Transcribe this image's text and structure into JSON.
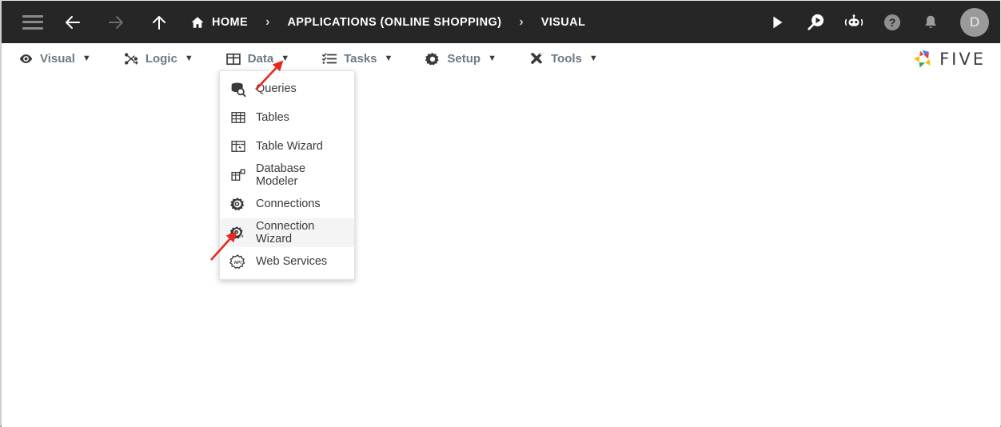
{
  "colors": {
    "topbar_bg": "#262626",
    "accent_bar": "#f5a623",
    "menu_label": "#6d7a86",
    "annotation_arrow": "#e8281e",
    "avatar_bg": "#9a9a9a",
    "dropdown_hover": "#f4f4f4"
  },
  "topbar": {
    "menu_toggle": "hamburger-icon",
    "back_label": "back-arrow-icon",
    "forward_label": "forward-arrow-icon",
    "up_label": "up-arrow-icon",
    "breadcrumbs": [
      {
        "label": "HOME",
        "icon": "home-icon"
      },
      {
        "label": "APPLICATIONS (ONLINE SHOPPING)",
        "icon": ""
      },
      {
        "label": "VISUAL",
        "icon": ""
      }
    ],
    "separator": "›",
    "actions": [
      {
        "name": "run-button",
        "icon": "play-icon"
      },
      {
        "name": "search-run-button",
        "icon": "search-play-icon"
      },
      {
        "name": "assistant-button",
        "icon": "robot-icon"
      },
      {
        "name": "help-button",
        "icon": "question-circle-icon"
      },
      {
        "name": "notifications-button",
        "icon": "bell-icon"
      }
    ],
    "avatar_initial": "D"
  },
  "menubar": {
    "items": [
      {
        "label": "Visual",
        "icon": "eye-icon",
        "caret": "▼"
      },
      {
        "label": "Logic",
        "icon": "nodes-icon",
        "caret": "▼"
      },
      {
        "label": "Data",
        "icon": "table-grid-icon",
        "caret": "▼"
      },
      {
        "label": "Tasks",
        "icon": "checklist-icon",
        "caret": "▼"
      },
      {
        "label": "Setup",
        "icon": "gear-icon",
        "caret": "▼"
      },
      {
        "label": "Tools",
        "icon": "tools-icon",
        "caret": "▼"
      }
    ],
    "brand": {
      "word": "FIVE",
      "logo_colors": [
        "#4285f4",
        "#ea4335",
        "#fbbc05",
        "#34a853"
      ]
    }
  },
  "data_menu": {
    "open": true,
    "items": [
      {
        "label": "Queries",
        "icon": "database-search-icon",
        "active": false
      },
      {
        "label": "Tables",
        "icon": "table-grid-icon",
        "active": false
      },
      {
        "label": "Table Wizard",
        "icon": "table-wizard-icon",
        "active": false
      },
      {
        "label": "Database Modeler",
        "icon": "database-modeler-icon",
        "active": false
      },
      {
        "label": "Connections",
        "icon": "connections-icon",
        "active": false
      },
      {
        "label": "Connection Wizard",
        "icon": "connection-wizard-icon",
        "active": true
      },
      {
        "label": "Web Services",
        "icon": "api-icon",
        "active": false
      }
    ]
  },
  "annotations": [
    {
      "name": "arrow-to-data-menu",
      "points_to": "Data"
    },
    {
      "name": "arrow-to-connection-wizard",
      "points_to": "Connection Wizard"
    }
  ]
}
